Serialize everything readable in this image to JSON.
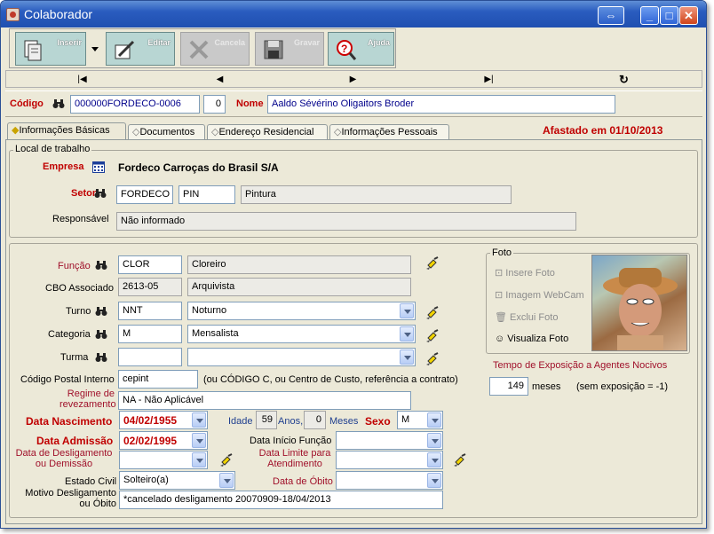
{
  "window": {
    "title": "Colaborador"
  },
  "toolbar": {
    "inserir": "Inserir",
    "editar": "Editar",
    "cancelar": "Cancela",
    "gravar": "Gravar",
    "ajuda": "Ajuda"
  },
  "nav": {
    "first": "|◀",
    "prev": "◀",
    "next": "▶",
    "last": "▶|",
    "refresh": "↻"
  },
  "header": {
    "codigo_label": "Código",
    "codigo_value": "000000FORDECO-0006",
    "seq_value": "0",
    "nome_label": "Nome",
    "nome_value": "Aaldo Sévérino Oligaitors Broder"
  },
  "tabs": [
    "Informações Básicas",
    "Documentos",
    "Endereço Residencial",
    "Informações Pessoais"
  ],
  "status": "Afastado em 01/10/2013",
  "local": {
    "group_label": "Local de trabalho",
    "empresa_label": "Empresa",
    "empresa_value": "Fordeco Carroças do Brasil S/A",
    "setor_label": "Setor",
    "setor_code": "FORDECO",
    "setor_sub": "PIN",
    "setor_name": "Pintura",
    "responsavel_label": "Responsável",
    "responsavel_value": "Não informado"
  },
  "form": {
    "funcao_label": "Função",
    "funcao_code": "CLOR",
    "funcao_name": "Cloreiro",
    "cbo_label": "CBO Associado",
    "cbo_code": "2613-05",
    "cbo_name": "Arquivista",
    "turno_label": "Turno",
    "turno_code": "NNT",
    "turno_name": "Noturno",
    "categoria_label": "Categoria",
    "categoria_code": "M",
    "categoria_name": "Mensalista",
    "turma_label": "Turma",
    "turma_code": "",
    "turma_name": "",
    "cpi_label": "Código Postal Interno",
    "cpi_value": "cepint",
    "cpi_hint": "(ou CÓDIGO C, ou Centro de Custo, referência a contrato)",
    "regime_label": "Regime de revezamento",
    "regime_value": "NA - Não Aplicável",
    "nasc_label": "Data Nascimento",
    "nasc_value": "04/02/1955",
    "idade_label": "Idade",
    "idade_value": "59",
    "anos_label": "Anos,",
    "meses_value": "0",
    "meses_label": "Meses",
    "sexo_label": "Sexo",
    "sexo_value": "M",
    "adm_label": "Data Admissão",
    "adm_value": "02/02/1995",
    "inicio_label": "Data Início Função",
    "inicio_value": "",
    "desl_label": "Data de Desligamento ou Demissão",
    "desl_value": "",
    "limite_label": "Data Limite para Atendimento",
    "limite_value": "",
    "civil_label": "Estado Civil",
    "civil_value": "Solteiro(a)",
    "obito_label": "Data de Óbito",
    "obito_value": "",
    "motivo_label": "Motivo Desligamento ou Óbito",
    "motivo_value": "*cancelado desligamento 20070909-18/04/2013"
  },
  "foto": {
    "group_label": "Foto",
    "insere": "Insere Foto",
    "webcam": "Imagem WebCam",
    "exclui": "Exclui Foto",
    "visualiza": "Visualiza Foto"
  },
  "exposicao": {
    "label": "Tempo de Exposição a Agentes Nocivos",
    "value": "149",
    "unit": "meses",
    "hint": "(sem exposição = -1)"
  }
}
